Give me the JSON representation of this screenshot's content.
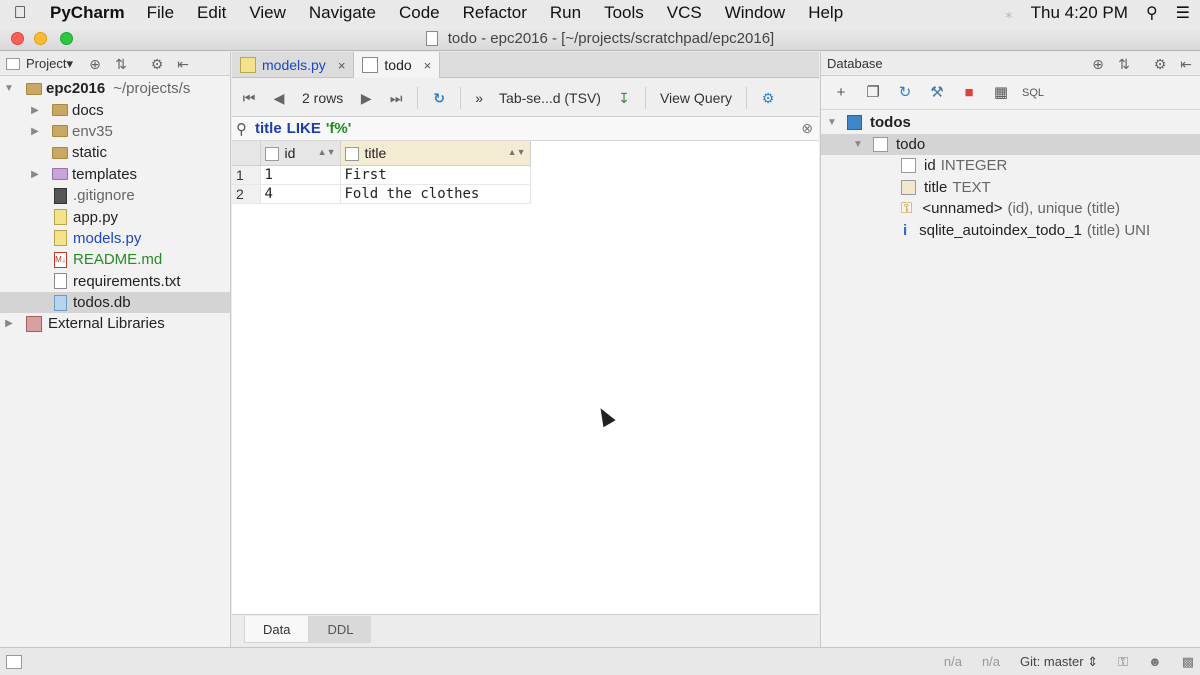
{
  "menubar": {
    "app_name": "PyCharm",
    "items": [
      "File",
      "Edit",
      "View",
      "Navigate",
      "Code",
      "Refactor",
      "Run",
      "Tools",
      "VCS",
      "Window",
      "Help"
    ],
    "clock": "Thu 4:20 PM"
  },
  "window": {
    "title": "todo - epc2016 - [~/projects/scratchpad/epc2016]"
  },
  "project_panel": {
    "dropdown_label": "Project▾",
    "root": {
      "name": "epc2016",
      "path": "~/projects/s"
    },
    "items": [
      {
        "label": "docs",
        "type": "folder"
      },
      {
        "label": "env35",
        "type": "folder"
      },
      {
        "label": "static",
        "type": "folder"
      },
      {
        "label": "templates",
        "type": "folder-purple"
      },
      {
        "label": ".gitignore",
        "type": "file"
      },
      {
        "label": "app.py",
        "type": "file"
      },
      {
        "label": "models.py",
        "type": "file"
      },
      {
        "label": "README.md",
        "type": "file"
      },
      {
        "label": "requirements.txt",
        "type": "file"
      },
      {
        "label": "todos.db",
        "type": "file"
      }
    ],
    "external": "External Libraries"
  },
  "editor_tabs": [
    {
      "label": "models.py",
      "close": "×"
    },
    {
      "label": "todo",
      "close": "×"
    }
  ],
  "db_toolbar": {
    "rows_label": "2 rows",
    "more": "»",
    "format_label": "Tab-se...d (TSV)",
    "view_query": "View Query"
  },
  "filter": {
    "field": "title",
    "keyword": "LIKE",
    "value": "'f%'"
  },
  "grid": {
    "columns": [
      "id",
      "title"
    ],
    "rows": [
      {
        "num": "1",
        "id": "1",
        "title": "First"
      },
      {
        "num": "2",
        "id": "4",
        "title": "Fold the clothes"
      }
    ]
  },
  "bottom_tabs": [
    "Data",
    "DDL"
  ],
  "database_panel": {
    "title": "Database",
    "schema": "todos",
    "table": "todo",
    "columns": [
      {
        "name": "id",
        "type": "INTEGER"
      },
      {
        "name": "title",
        "type": "TEXT"
      }
    ],
    "key": {
      "name": "<unnamed>",
      "detail": "(id), unique (title)"
    },
    "index": {
      "name": "sqlite_autoindex_todo_1",
      "detail": "(title) UNI"
    }
  },
  "statusbar": {
    "pos1": "n/a",
    "pos2": "n/a",
    "git": "Git: master ⇕"
  },
  "colors": {
    "selection": "#d4d4d4",
    "folder": "#c9a866",
    "sql_keyword": "#1c3db0",
    "sql_string": "#1f8a1f",
    "vcs_modified": "#1c47c5",
    "vcs_added": "#2a8a2a"
  }
}
